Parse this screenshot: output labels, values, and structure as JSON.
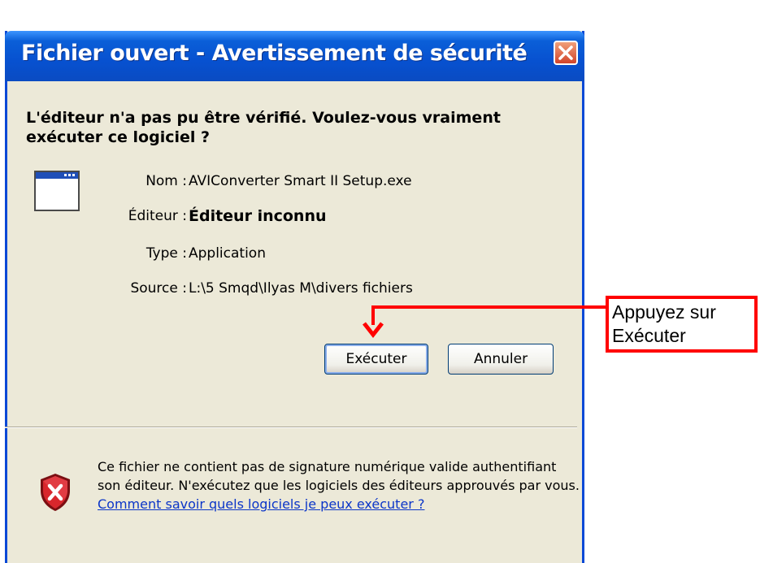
{
  "window": {
    "title": "Fichier ouvert - Avertissement de sécurité",
    "close_icon": "close-icon"
  },
  "question": "L'éditeur n'a pas pu être vérifié. Voulez-vous vraiment exécuter ce logiciel ?",
  "file_info": {
    "name_label": "Nom :",
    "name_value": "AVIConverter Smart II Setup.exe",
    "publisher_label": "Éditeur :",
    "publisher_value": "Éditeur inconnu",
    "type_label": "Type :",
    "type_value": "Application",
    "source_label": "Source :",
    "source_value": "L:\\5 Smqd\\Ilyas M\\divers fichiers"
  },
  "buttons": {
    "run_label": "Exécuter",
    "cancel_label": "Annuler"
  },
  "warning": {
    "text": "Ce fichier ne contient pas de signature numérique valide authentifiant son éditeur. N'exécutez que les logiciels des éditeurs approuvés par vous.",
    "link": "Comment savoir quels logiciels je peux exécuter ?",
    "icon": "shield-warning-icon"
  },
  "callout": {
    "text": "Appuyez sur Exécuter",
    "color": "#ff0000"
  },
  "colors": {
    "titlebar": "#0a5fd8",
    "dialog_bg": "#ece9d8",
    "link": "#0b35c8"
  }
}
